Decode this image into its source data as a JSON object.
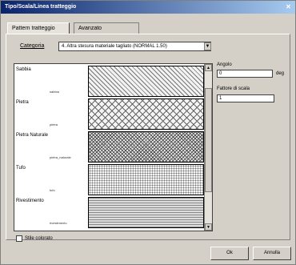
{
  "window": {
    "title": "Tipo/Scala/Linea tratteggio"
  },
  "tabs": [
    {
      "label": "Pattern tratteggio"
    },
    {
      "label": "Avanzato"
    }
  ],
  "category": {
    "label": "Categoria",
    "selected": "4. Altra stesura materiale tagliato (NORMAL 1.50)"
  },
  "patterns": [
    {
      "label": "Sabbia",
      "code": "sabbia",
      "pattern": "diagonal"
    },
    {
      "label": "Pietra",
      "code": "pietra",
      "pattern": "crosshatch"
    },
    {
      "label": "Pietra Naturale",
      "code": "pietra_naturale",
      "pattern": "dense"
    },
    {
      "label": "Tufo",
      "code": "tufo",
      "pattern": "dots"
    },
    {
      "label": "Rivestimento",
      "code": "rivestimento",
      "pattern": "horizontal"
    }
  ],
  "angle": {
    "label": "Angolo",
    "value": "0",
    "unit": "deg"
  },
  "scale": {
    "label": "Fattore di scala",
    "value": "1"
  },
  "checkbox": {
    "label": "Stile colorato"
  },
  "buttons": {
    "ok": "Ok",
    "cancel": "Annulla"
  }
}
